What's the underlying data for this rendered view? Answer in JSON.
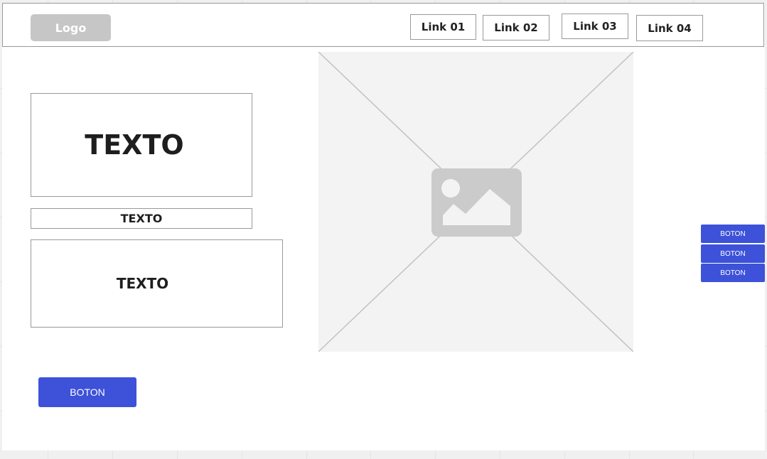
{
  "header": {
    "logo": "Logo",
    "links": [
      "Link 01",
      "Link 02",
      "Link 03",
      "Link 04"
    ]
  },
  "main": {
    "text_large": "TEXTO",
    "text_small": "TEXTO",
    "text_medium": "TEXTO",
    "primary_button": "BOTON"
  },
  "side_buttons": [
    "BOTON",
    "BOTON",
    "BOTON"
  ],
  "colors": {
    "button": "#3d52d9",
    "placeholder": "#c6c6c6",
    "border": "#999999"
  }
}
